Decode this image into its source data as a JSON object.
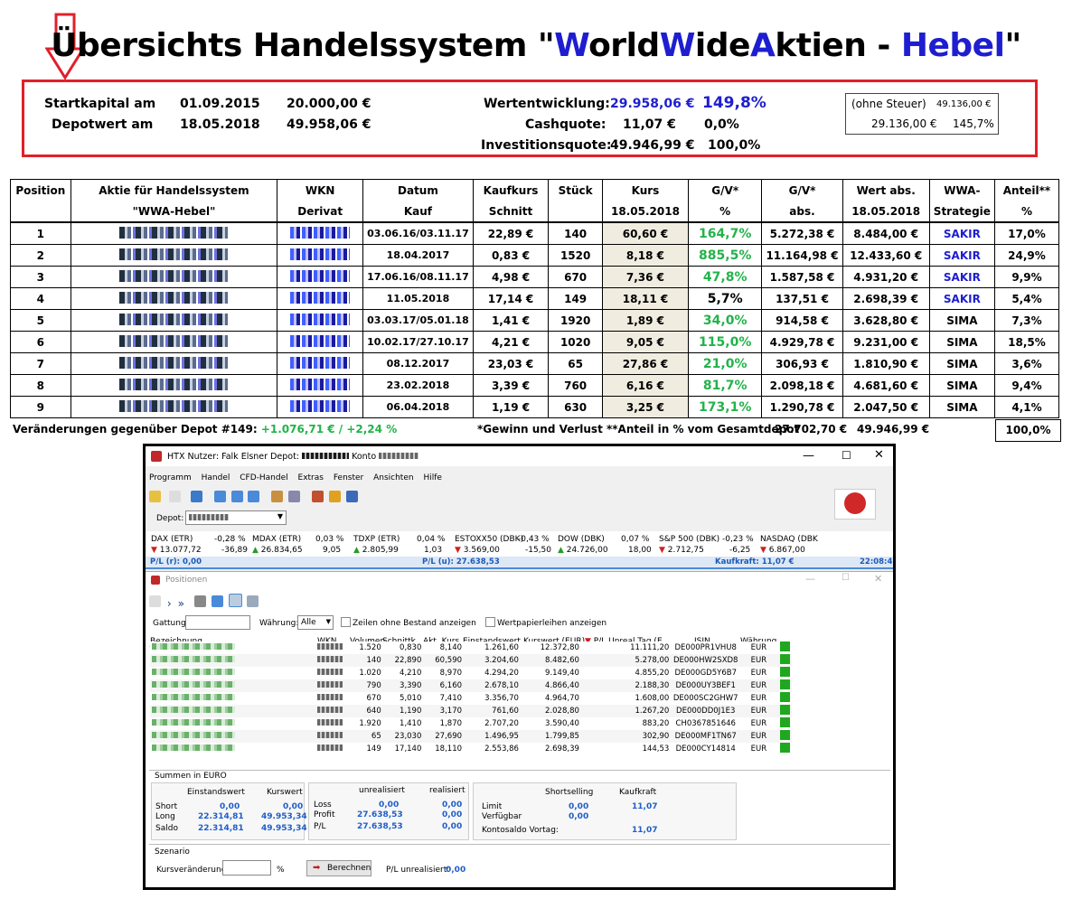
{
  "title": {
    "part1": "Übersichts Handelssystem \"",
    "w1": "W",
    "orld": "orld",
    "w2": "W",
    "ide": "ide",
    "a": "A",
    "ktien": "ktien - ",
    "hebel": "Hebel",
    "end": "\""
  },
  "summary": {
    "startkapital_label": "Startkapital am",
    "startkapital_date": "01.09.2015",
    "startkapital_value": "20.000,00 €",
    "depotwert_label": "Depotwert am",
    "depotwert_date": "18.05.2018",
    "depotwert_value": "49.958,06 €",
    "wertentwicklung_label": "Wertentwicklung:",
    "wertentwicklung_value": "29.958,06 €",
    "wertentwicklung_pct": "149,8%",
    "cashquote_label": "Cashquote:",
    "cashquote_value": "11,07 €",
    "cashquote_pct": "0,0%",
    "investitionsquote_label": "Investitionsquote:",
    "investitionsquote_value": "49.946,99 €",
    "investitionsquote_pct": "100,0%",
    "ohne_steuer_label": "(ohne Steuer)",
    "ohne_steuer_value": "49.136,00 €",
    "ohne_steuer_value2": "29.136,00 €",
    "ohne_steuer_pct": "145,7%"
  },
  "table": {
    "head1": [
      "Position",
      "Aktie für Handelssystem",
      "WKN",
      "Datum",
      "Kaufkurs",
      "Stück",
      "Kurs",
      "G/V*",
      "G/V*",
      "Wert abs.",
      "WWA-",
      "Anteil**"
    ],
    "head2": [
      "",
      "\"WWA-Hebel\"",
      "Derivat",
      "Kauf",
      "Schnitt",
      "",
      "18.05.2018",
      "%",
      "abs.",
      "18.05.2018",
      "Strategie",
      "%"
    ],
    "rows": [
      {
        "pos": "1",
        "datum": "03.06.16/03.11.17",
        "kaufkurs": "22,89 €",
        "stueck": "140",
        "kurs": "60,60 €",
        "gv_pct": "164,7%",
        "gv_abs": "5.272,38 €",
        "wert": "8.484,00 €",
        "strat": "SAKIR",
        "anteil": "17,0%"
      },
      {
        "pos": "2",
        "datum": "18.04.2017",
        "kaufkurs": "0,83 €",
        "stueck": "1520",
        "kurs": "8,18 €",
        "gv_pct": "885,5%",
        "gv_abs": "11.164,98 €",
        "wert": "12.433,60 €",
        "strat": "SAKIR",
        "anteil": "24,9%"
      },
      {
        "pos": "3",
        "datum": "17.06.16/08.11.17",
        "kaufkurs": "4,98 €",
        "stueck": "670",
        "kurs": "7,36 €",
        "gv_pct": "47,8%",
        "gv_abs": "1.587,58 €",
        "wert": "4.931,20 €",
        "strat": "SAKIR",
        "anteil": "9,9%"
      },
      {
        "pos": "4",
        "datum": "11.05.2018",
        "kaufkurs": "17,14 €",
        "stueck": "149",
        "kurs": "18,11 €",
        "gv_pct": "5,7%",
        "gv_abs": "137,51 €",
        "wert": "2.698,39 €",
        "strat": "SAKIR",
        "anteil": "5,4%"
      },
      {
        "pos": "5",
        "datum": "03.03.17/05.01.18",
        "kaufkurs": "1,41 €",
        "stueck": "1920",
        "kurs": "1,89 €",
        "gv_pct": "34,0%",
        "gv_abs": "914,58 €",
        "wert": "3.628,80 €",
        "strat": "SIMA",
        "anteil": "7,3%"
      },
      {
        "pos": "6",
        "datum": "10.02.17/27.10.17",
        "kaufkurs": "4,21 €",
        "stueck": "1020",
        "kurs": "9,05 €",
        "gv_pct": "115,0%",
        "gv_abs": "4.929,78 €",
        "wert": "9.231,00 €",
        "strat": "SIMA",
        "anteil": "18,5%"
      },
      {
        "pos": "7",
        "datum": "08.12.2017",
        "kaufkurs": "23,03 €",
        "stueck": "65",
        "kurs": "27,86 €",
        "gv_pct": "21,0%",
        "gv_abs": "306,93 €",
        "wert": "1.810,90 €",
        "strat": "SIMA",
        "anteil": "3,6%"
      },
      {
        "pos": "8",
        "datum": "23.02.2018",
        "kaufkurs": "3,39 €",
        "stueck": "760",
        "kurs": "6,16 €",
        "gv_pct": "81,7%",
        "gv_abs": "2.098,18 €",
        "wert": "4.681,60 €",
        "strat": "SIMA",
        "anteil": "9,4%"
      },
      {
        "pos": "9",
        "datum": "06.04.2018",
        "kaufkurs": "1,19 €",
        "stueck": "630",
        "kurs": "3,25 €",
        "gv_pct": "173,1%",
        "gv_abs": "1.290,78 €",
        "wert": "2.047,50 €",
        "strat": "SIMA",
        "anteil": "4,1%"
      }
    ],
    "footer_left": "Veränderungen gegenüber Depot #149: ",
    "footer_change": "+1.076,71 € / +2,24 %",
    "footer_note": "*Gewinn und Verlust  **Anteil in % vom Gesamtdepot",
    "footer_gv_total": "27.702,70 €",
    "footer_wert_total": "49.946,99 €",
    "footer_anteil_total": "100,0%"
  },
  "app": {
    "title": "HTX  Nutzer: Falk Elsner  Depot:",
    "konto_label": "Konto",
    "menu": [
      "Programm",
      "Handel",
      "CFD-Handel",
      "Extras",
      "Fenster",
      "Ansichten",
      "Hilfe"
    ],
    "depot_label": "Depot:",
    "tickers": [
      {
        "name": "DAX (ETR)",
        "pct": "-0,28 %",
        "price": "13.077,72",
        "chg": "-36,89",
        "dir": "dn"
      },
      {
        "name": "MDAX (ETR)",
        "pct": "0,03 %",
        "price": "26.834,65",
        "chg": "9,05",
        "dir": "up"
      },
      {
        "name": "TDXP (ETR)",
        "pct": "0,04 %",
        "price": "2.805,99",
        "chg": "1,03",
        "dir": "up"
      },
      {
        "name": "ESTOXX50 (DBK)",
        "pct": "-0,43 %",
        "price": "3.569,00",
        "chg": "-15,50",
        "dir": "dn"
      },
      {
        "name": "DOW (DBK)",
        "pct": "0,07 %",
        "price": "24.726,00",
        "chg": "18,00",
        "dir": "up"
      },
      {
        "name": "S&P 500 (DBK)",
        "pct": "-0,23 %",
        "price": "2.712,75",
        "chg": "-6,25",
        "dir": "dn"
      },
      {
        "name": "NASDAQ (DBK",
        "pct": "",
        "price": "6.867,00",
        "chg": "",
        "dir": "dn"
      }
    ],
    "pl_r": "P/L (r): 0,00",
    "pl_u": "P/L (u): 27.638,53",
    "kaufkraft": "Kaufkraft: 11,07 €",
    "time": "22:08:41",
    "positionen_title": "Positionen",
    "gattung_label": "Gattung",
    "waehrung_label": "Währung:",
    "waehrung_value": "Alle",
    "cb_zeilen": "Zeilen ohne Bestand anzeigen",
    "cb_wp": "Wertpapierleihen anzeigen",
    "cols": [
      "Bezeichnung",
      "WKN",
      "Volumen",
      "Schnittk...",
      "Akt. Kurs",
      "Einstandswert",
      "Kurswert (EUR)",
      "P/L Unreal Tag (E...",
      "ISIN",
      "Währung"
    ],
    "positions": [
      {
        "vol": "1.520",
        "schnitt": "0,830",
        "akt": "8,140",
        "einstand": "1.261,60",
        "kurswert": "12.372,80",
        "pl": "11.111,20",
        "isin": "DE000PR1VHU8",
        "cur": "EUR"
      },
      {
        "vol": "140",
        "schnitt": "22,890",
        "akt": "60,590",
        "einstand": "3.204,60",
        "kurswert": "8.482,60",
        "pl": "5.278,00",
        "isin": "DE000HW2SXD8",
        "cur": "EUR"
      },
      {
        "vol": "1.020",
        "schnitt": "4,210",
        "akt": "8,970",
        "einstand": "4.294,20",
        "kurswert": "9.149,40",
        "pl": "4.855,20",
        "isin": "DE000GD5Y6B7",
        "cur": "EUR"
      },
      {
        "vol": "790",
        "schnitt": "3,390",
        "akt": "6,160",
        "einstand": "2.678,10",
        "kurswert": "4.866,40",
        "pl": "2.188,30",
        "isin": "DE000UY3BEF1",
        "cur": "EUR"
      },
      {
        "vol": "670",
        "schnitt": "5,010",
        "akt": "7,410",
        "einstand": "3.356,70",
        "kurswert": "4.964,70",
        "pl": "1.608,00",
        "isin": "DE000SC2GHW7",
        "cur": "EUR"
      },
      {
        "vol": "640",
        "schnitt": "1,190",
        "akt": "3,170",
        "einstand": "761,60",
        "kurswert": "2.028,80",
        "pl": "1.267,20",
        "isin": "DE000DD0J1E3",
        "cur": "EUR"
      },
      {
        "vol": "1.920",
        "schnitt": "1,410",
        "akt": "1,870",
        "einstand": "2.707,20",
        "kurswert": "3.590,40",
        "pl": "883,20",
        "isin": "CH0367851646",
        "cur": "EUR"
      },
      {
        "vol": "65",
        "schnitt": "23,030",
        "akt": "27,690",
        "einstand": "1.496,95",
        "kurswert": "1.799,85",
        "pl": "302,90",
        "isin": "DE000MF1TN67",
        "cur": "EUR"
      },
      {
        "vol": "149",
        "schnitt": "17,140",
        "akt": "18,110",
        "einstand": "2.553,86",
        "kurswert": "2.698,39",
        "pl": "144,53",
        "isin": "DE000CY14814",
        "cur": "EUR"
      }
    ],
    "summen_label": "Summen in EURO",
    "s_einstand": "Einstandswert",
    "s_kurswert": "Kurswert",
    "short_label": "Short",
    "long_label": "Long",
    "saldo_label": "Saldo",
    "short_e": "0,00",
    "short_k": "0,00",
    "long_e": "22.314,81",
    "long_k": "49.953,34",
    "saldo_e": "22.314,81",
    "saldo_k": "49.953,34",
    "unreal_label": "unrealisiert",
    "real_label": "realisiert",
    "loss_label": "Loss",
    "profit_label": "Profit",
    "pl_label": "P/L",
    "loss_u": "0,00",
    "loss_r": "0,00",
    "profit_u": "27.638,53",
    "profit_r": "0,00",
    "pl_u2": "27.638,53",
    "pl_r2": "0,00",
    "shortselling_label": "Shortselling",
    "kaufkraft_label": "Kaufkraft",
    "limit_label": "Limit",
    "verf_label": "Verfügbar",
    "kontosaldo_label": "Kontosaldo Vortag:",
    "limit_s": "0,00",
    "limit_k": "11,07",
    "verf_s": "0,00",
    "kontosaldo_v": "11,07",
    "szenario_label": "Szenario",
    "kursver_label": "Kursveränderung:",
    "pct_sign": "%",
    "berechnen": "Berechnen",
    "plunreal_label": "P/L unrealisiert:",
    "plunreal_value": "0,00"
  }
}
